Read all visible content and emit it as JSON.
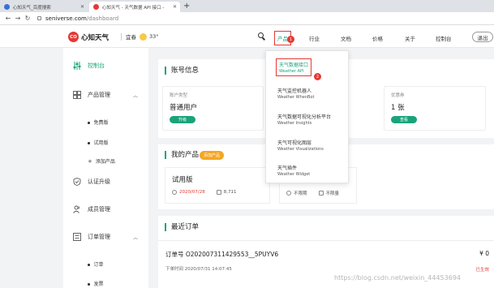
{
  "browser": {
    "tabs": [
      {
        "title": "心知天气_百度搜索"
      },
      {
        "title": "心知天气 - 天气数据 API 接口 -"
      }
    ],
    "new_tab": "+",
    "url_host": "seniverse.com",
    "url_path": "/dashboard"
  },
  "header": {
    "logo_mark": "CO",
    "logo_name": "心知天气",
    "city": "宜春",
    "temp": "33°",
    "nav": [
      "产品",
      "行业",
      "文档",
      "价格",
      "关于",
      "控制台"
    ],
    "logout": "退出",
    "badge_products": "1"
  },
  "dropdown": {
    "items": [
      {
        "zh": "天气数据接口",
        "en": "Weather API"
      },
      {
        "zh": "天气监控机器人",
        "en": "Weather WhenBot"
      },
      {
        "zh": "天气数据可视化分析平台",
        "en": "Weather Insights"
      },
      {
        "zh": "天气可视化图层",
        "en": "Weather Visualizations"
      },
      {
        "zh": "天气插件",
        "en": "Weather Widget"
      }
    ],
    "badge": "2"
  },
  "sidebar": {
    "items": [
      {
        "label": "控制台"
      },
      {
        "label": "产品管理"
      },
      {
        "label": "认证升级"
      },
      {
        "label": "成员管理"
      },
      {
        "label": "订单管理"
      }
    ],
    "product_subs": [
      "免费版",
      "试用版",
      "添加产品"
    ],
    "order_subs": [
      "订单",
      "发票"
    ]
  },
  "account": {
    "title": "账号信息",
    "type_label": "账户类型",
    "type_value": "普通用户",
    "upgrade": "升级",
    "coupon_label": "优惠券",
    "coupon_value": "1 张",
    "view": "查看"
  },
  "products": {
    "title": "我的产品",
    "add": "添加产品",
    "card1": {
      "name": "试用版",
      "date": "2020/07/28",
      "count": "8,711"
    },
    "card2": {
      "unlimited_a": "不限期",
      "unlimited_b": "不限量"
    }
  },
  "orders": {
    "title": "最近订单",
    "order_no": "订单号 O202007311429553__5PUYV6",
    "time": "下单时间 2020/07/31 14:07:45",
    "price": "¥ 0",
    "status": "已生效"
  },
  "watermark": "https://blog.csdn.net/weixin_44453694",
  "colors": {
    "accent": "#1aa37a",
    "highlight": "#e53935",
    "badge": "#f5a623"
  }
}
